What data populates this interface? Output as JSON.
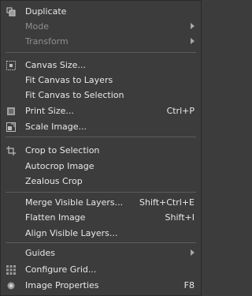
{
  "menu": {
    "items": [
      {
        "label": "Duplicate",
        "shortcut": "",
        "icon": "duplicate-icon",
        "enabled": true,
        "submenu": false
      },
      {
        "label": "Mode",
        "shortcut": "",
        "icon": "",
        "enabled": false,
        "submenu": true
      },
      {
        "label": "Transform",
        "shortcut": "",
        "icon": "",
        "enabled": false,
        "submenu": true
      },
      {
        "label": "Canvas Size...",
        "shortcut": "",
        "icon": "canvas-size-icon",
        "enabled": true,
        "submenu": false
      },
      {
        "label": "Fit Canvas to Layers",
        "shortcut": "",
        "icon": "",
        "enabled": true,
        "submenu": false
      },
      {
        "label": "Fit Canvas to Selection",
        "shortcut": "",
        "icon": "",
        "enabled": true,
        "submenu": false
      },
      {
        "label": "Print Size...",
        "shortcut": "Ctrl+P",
        "icon": "print-size-icon",
        "enabled": true,
        "submenu": false
      },
      {
        "label": "Scale Image...",
        "shortcut": "",
        "icon": "scale-image-icon",
        "enabled": true,
        "submenu": false
      },
      {
        "label": "Crop to Selection",
        "shortcut": "",
        "icon": "crop-icon",
        "enabled": true,
        "submenu": false
      },
      {
        "label": "Autocrop Image",
        "shortcut": "",
        "icon": "",
        "enabled": true,
        "submenu": false
      },
      {
        "label": "Zealous Crop",
        "shortcut": "",
        "icon": "",
        "enabled": true,
        "submenu": false
      },
      {
        "label": "Merge Visible Layers...",
        "shortcut": "Shift+Ctrl+E",
        "icon": "",
        "enabled": true,
        "submenu": false
      },
      {
        "label": "Flatten Image",
        "shortcut": "Shift+I",
        "icon": "",
        "enabled": true,
        "submenu": false
      },
      {
        "label": "Align Visible Layers...",
        "shortcut": "",
        "icon": "",
        "enabled": true,
        "submenu": false
      },
      {
        "label": "Guides",
        "shortcut": "",
        "icon": "",
        "enabled": false,
        "submenu": true
      },
      {
        "label": "Configure Grid...",
        "shortcut": "",
        "icon": "grid-icon",
        "enabled": true,
        "submenu": false
      },
      {
        "label": "Image Properties",
        "shortcut": "F8",
        "icon": "image-properties-icon",
        "enabled": true,
        "submenu": false
      }
    ]
  }
}
